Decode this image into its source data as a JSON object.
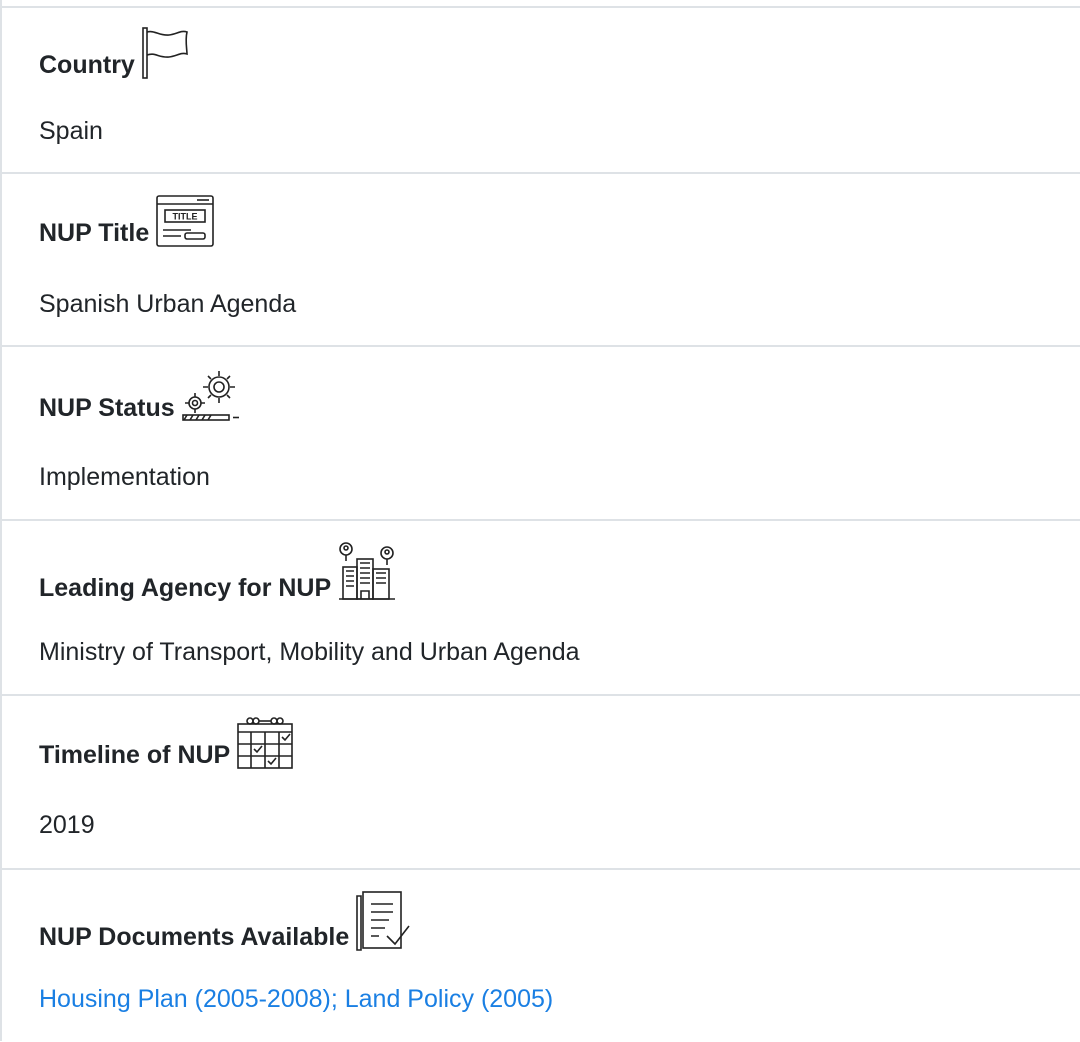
{
  "fields": [
    {
      "label": "Country",
      "value": "Spain",
      "icon": "flag-icon"
    },
    {
      "label": "NUP Title",
      "value": "Spanish Urban Agenda",
      "icon": "title-icon"
    },
    {
      "label": "NUP Status",
      "value": "Implementation",
      "icon": "gears-progress-icon"
    },
    {
      "label": "Leading Agency for NUP",
      "value": "Ministry of Transport, Mobility and Urban Agenda",
      "icon": "buildings-people-icon"
    },
    {
      "label": "Timeline of NUP",
      "value": "2019",
      "icon": "calendar-icon"
    },
    {
      "label": "NUP Documents Available",
      "value": "Housing Plan (2005-2008); Land Policy (2005)",
      "icon": "document-check-icon"
    }
  ],
  "icon_title_text": "TITLE",
  "colors": {
    "text": "#212529",
    "link": "#1a7fe3",
    "divider": "#dee2e6"
  }
}
